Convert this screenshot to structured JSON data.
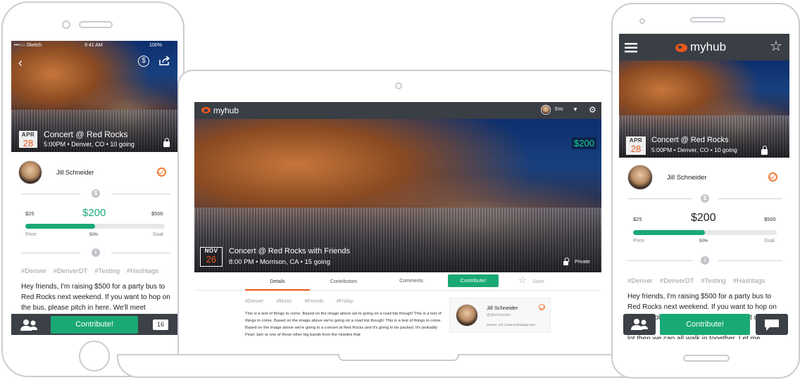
{
  "iphone": {
    "status": {
      "carrier": "•••○○ Sketch",
      "time": "9:41 AM",
      "battery": "100%"
    },
    "event": {
      "month": "APR",
      "day": "28",
      "title": "Concert @ Red Rocks",
      "time": "5:00PM",
      "location": "Denver, CO",
      "going": "10 going"
    },
    "user_name": "Jill Schneider",
    "funding": {
      "min": "$25",
      "raised": "$200",
      "goal": "$500",
      "progress_pct": 50,
      "min_label": "Price",
      "pct_label": "50%",
      "goal_label": "Goal"
    },
    "tags": [
      "#Denver",
      "#DenverDT",
      "#Testing",
      "#Hashtags"
    ],
    "description": "Hey friends, I'm raising $500 for a party bus to Red Rocks next weekend. If you want to hop on the bus, please pitch in here. We'll meet",
    "contribute_label": "Contribute!",
    "comment_count": "16"
  },
  "laptop": {
    "brand": "myhub",
    "user": "Eric",
    "price_badge": "$200",
    "event": {
      "month": "NOV",
      "day": "26",
      "title": "Concert @ Red Rocks with Friends",
      "time": "8:00 PM",
      "location": "Morrison, CA",
      "going": "15 going",
      "privacy": "Private"
    },
    "tabs": [
      "Details",
      "Contributors",
      "Comments"
    ],
    "contribute_label": "Contribute!",
    "save_label": "Save",
    "tags": [
      "#Denver",
      "#Music",
      "#Friends",
      "#Friday"
    ],
    "description": "This is a test of things to come. Based on the image above we're going on a road trip though! This is a test of things to come. Based on the image above we're going on a road trip though! This is a test of things to come. Based on the image above we're going to a concert at Red Rocks and it's going to be packed. It's probably Pearl Jam or one of those other big bands from the nineties that",
    "host": {
      "name": "Jill Schneider",
      "handle": "@jillschneider",
      "meta": "Denver, CO | www.myhubapp.com"
    }
  },
  "android": {
    "brand": "myhub",
    "event": {
      "month": "APR",
      "day": "28",
      "title": "Concert @ Red Rocks",
      "time": "5:00PM",
      "location": "Denver, CO",
      "going": "10 going"
    },
    "user_name": "Jill Schneider",
    "funding": {
      "min": "$25",
      "raised": "$200",
      "goal": "$500",
      "progress_pct": 50,
      "min_label": "Price",
      "pct_label": "50%",
      "goal_label": "Goal"
    },
    "tags": [
      "#Denver",
      "#DenverDT",
      "#Testing",
      "#Hashtags"
    ],
    "description": "Hey friends, I'm raising $500 for a party bus to Red Rocks next weekend. If you want to hop on the bus, please pitch in here. We'll meet up at",
    "description_tail": "lot then we can all walk in together. Let me",
    "contribute_label": "Contribute!"
  },
  "colors": {
    "accent_green": "#19a975",
    "brand_orange": "#e9561d",
    "dark_bar": "#3a3e45"
  }
}
